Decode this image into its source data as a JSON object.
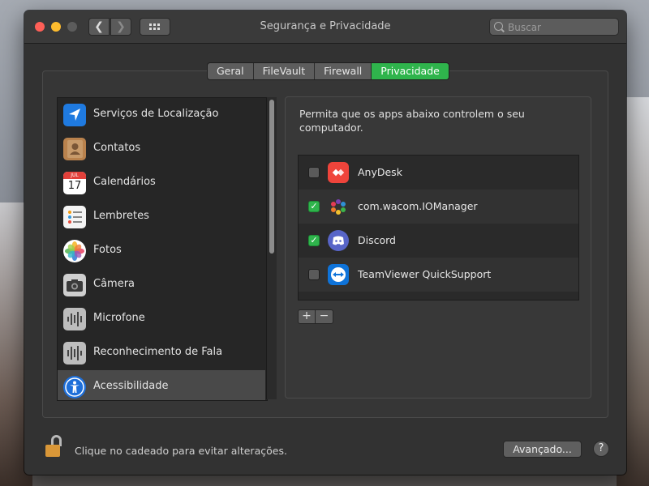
{
  "window": {
    "title": "Segurança e Privacidade",
    "search_placeholder": "Buscar"
  },
  "tabs": [
    {
      "label": "Geral",
      "active": false
    },
    {
      "label": "FileVault",
      "active": false
    },
    {
      "label": "Firewall",
      "active": false
    },
    {
      "label": "Privacidade",
      "active": true
    }
  ],
  "sidebar": {
    "items": [
      {
        "label": "Serviços de Localização",
        "icon": "location-icon",
        "selected": false
      },
      {
        "label": "Contatos",
        "icon": "contacts-icon",
        "selected": false
      },
      {
        "label": "Calendários",
        "icon": "calendar-icon",
        "selected": false
      },
      {
        "label": "Lembretes",
        "icon": "reminders-icon",
        "selected": false
      },
      {
        "label": "Fotos",
        "icon": "photos-icon",
        "selected": false
      },
      {
        "label": "Câmera",
        "icon": "camera-icon",
        "selected": false
      },
      {
        "label": "Microfone",
        "icon": "microphone-icon",
        "selected": false
      },
      {
        "label": "Reconhecimento de Fala",
        "icon": "speech-recognition-icon",
        "selected": false
      },
      {
        "label": "Acessibilidade",
        "icon": "accessibility-icon",
        "selected": true
      }
    ],
    "calendar_icon_month": "JUL",
    "calendar_icon_day": "17"
  },
  "main": {
    "description": "Permita que os apps abaixo controlem o seu computador.",
    "apps": [
      {
        "name": "AnyDesk",
        "checked": false,
        "icon": "anydesk-icon"
      },
      {
        "name": "com.wacom.IOManager",
        "checked": true,
        "icon": "wacom-icon"
      },
      {
        "name": "Discord",
        "checked": true,
        "icon": "discord-icon"
      },
      {
        "name": "TeamViewer QuickSupport",
        "checked": false,
        "icon": "teamviewer-icon"
      }
    ],
    "add_label": "+",
    "remove_label": "−"
  },
  "footer": {
    "lock_text": "Clique no cadeado para evitar alterações.",
    "advanced_label": "Avançado...",
    "help_label": "?"
  },
  "colors": {
    "accent_green": "#2fb44c",
    "window_bg": "#323232"
  }
}
